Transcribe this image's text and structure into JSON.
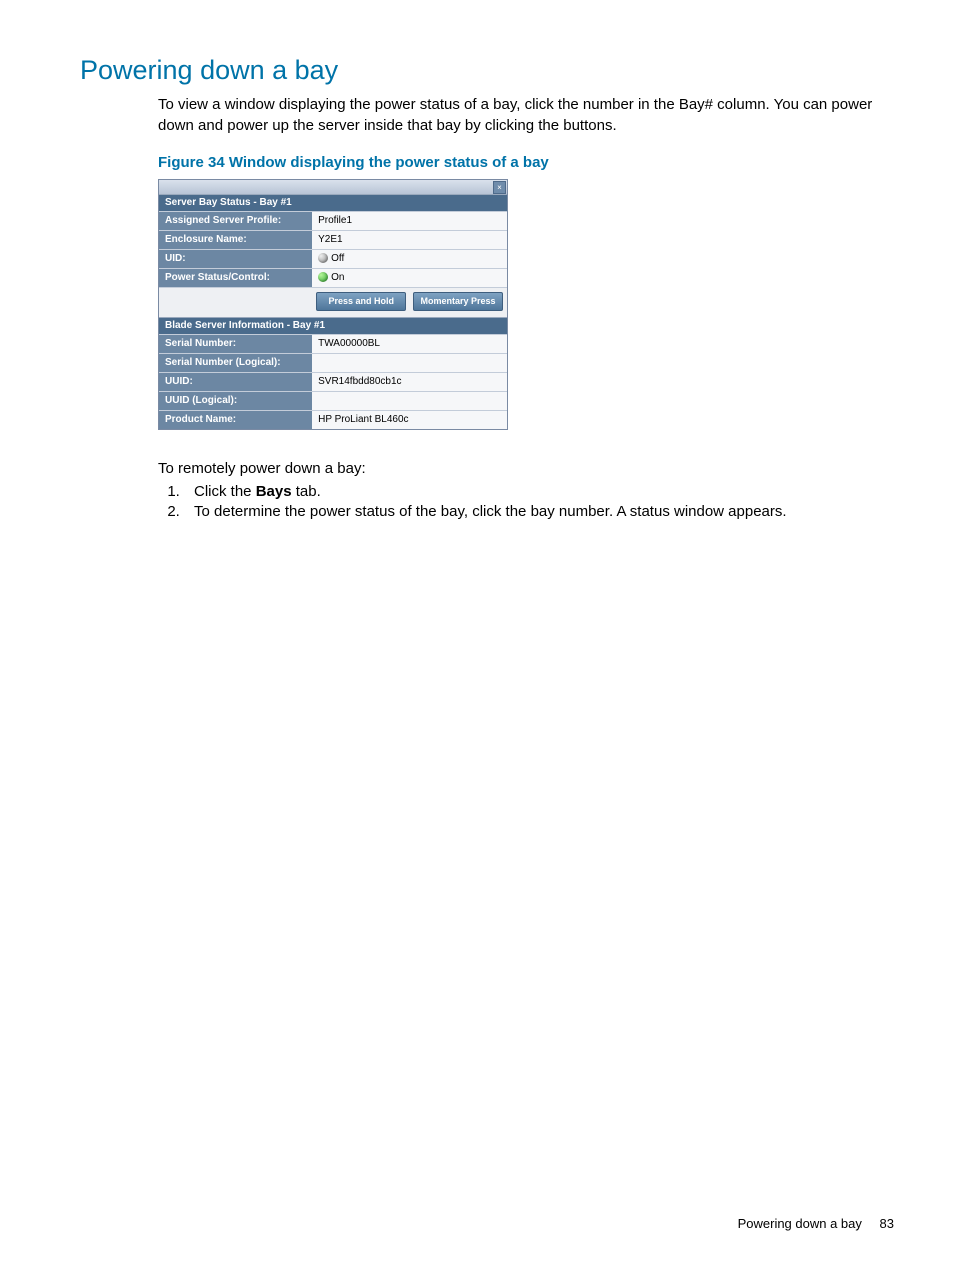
{
  "heading": "Powering down a bay",
  "intro": "To view a window displaying the power status of a bay, click the number in the Bay# column. You can power down and power up the server inside that bay by clicking the buttons.",
  "figure_caption": "Figure 34 Window displaying the power status of a bay",
  "window": {
    "close_glyph": "×",
    "section1_title": "Server Bay Status - Bay #1",
    "rows1": {
      "profile_k": "Assigned Server Profile:",
      "profile_v": "Profile1",
      "enclosure_k": "Enclosure Name:",
      "enclosure_v": "Y2E1",
      "uid_k": "UID:",
      "uid_v": "Off",
      "power_k": "Power Status/Control:",
      "power_v": "On"
    },
    "btn1": "Press and Hold",
    "btn2": "Momentary Press",
    "section2_title": "Blade Server Information - Bay #1",
    "rows2": {
      "serial_k": "Serial Number:",
      "serial_v": "TWA00000BL",
      "seriall_k": "Serial Number (Logical):",
      "seriall_v": "",
      "uuid_k": "UUID:",
      "uuid_v": "SVR14fbdd80cb1c",
      "uuidl_k": "UUID (Logical):",
      "uuidl_v": "",
      "product_k": "Product Name:",
      "product_v": "HP ProLiant BL460c"
    }
  },
  "after_fig": "To remotely power down a bay:",
  "steps": {
    "s1_pre": "Click the ",
    "s1_bold": "Bays",
    "s1_post": " tab.",
    "s2": "To determine the power status of the bay, click the bay number. A status window appears."
  },
  "footer_text": "Powering down a bay",
  "footer_page": "83"
}
